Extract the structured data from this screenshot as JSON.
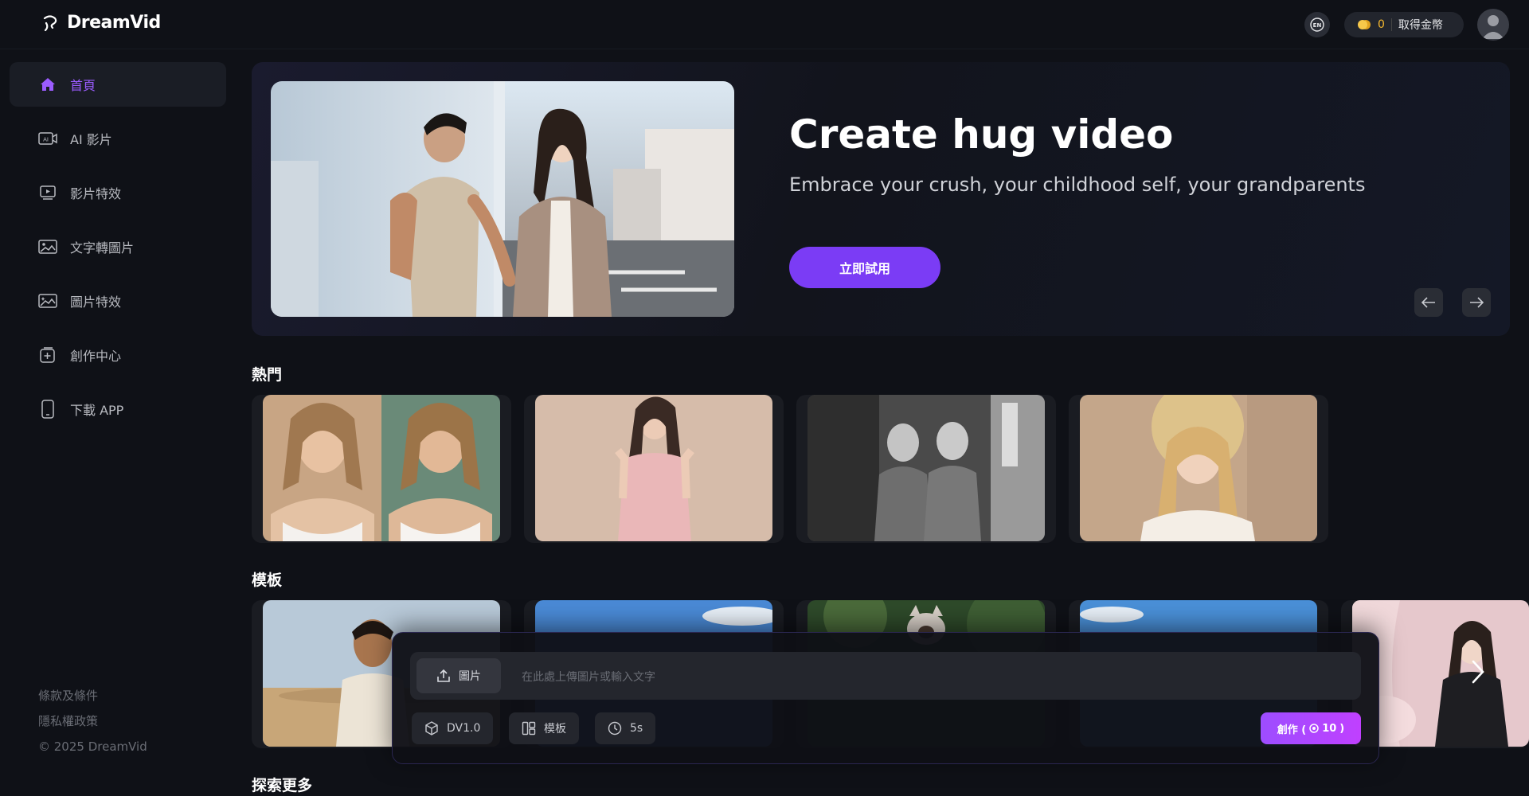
{
  "header": {
    "brand": "DreamVid",
    "lang_label": "EN",
    "coins": "0",
    "get_coins_label": "取得金幣"
  },
  "sidebar": {
    "items": [
      {
        "label": "首頁",
        "icon": "home-icon",
        "active": true
      },
      {
        "label": "AI 影片",
        "icon": "ai-video-icon"
      },
      {
        "label": "影片特效",
        "icon": "video-effects-icon"
      },
      {
        "label": "文字轉圖片",
        "icon": "text-to-image-icon"
      },
      {
        "label": "圖片特效",
        "icon": "image-effects-icon"
      },
      {
        "label": "創作中心",
        "icon": "creation-center-icon"
      },
      {
        "label": "下載 APP",
        "icon": "mobile-app-icon"
      }
    ],
    "footer": {
      "terms": "條款及條件",
      "privacy": "隱私權政策",
      "copyright": "© 2025 DreamVid"
    }
  },
  "hero": {
    "title": "Create hug video",
    "subtitle": "Embrace your crush, your childhood self, your grandparents",
    "cta": "立即試用"
  },
  "sections": {
    "popular": "熱門",
    "templates": "模板",
    "explore": "探索更多"
  },
  "composer": {
    "upload_label": "圖片",
    "placeholder": "在此處上傳圖片或輸入文字",
    "model_label": "DV1.0",
    "template_label": "模板",
    "duration_label": "5s",
    "create_label": "創作 (",
    "create_cost": "10",
    "create_close": ")"
  },
  "colors": {
    "accent": "#7b3cf5",
    "active_nav": "#9b5cff",
    "coin": "#f5b82e",
    "background": "#0f1117"
  }
}
